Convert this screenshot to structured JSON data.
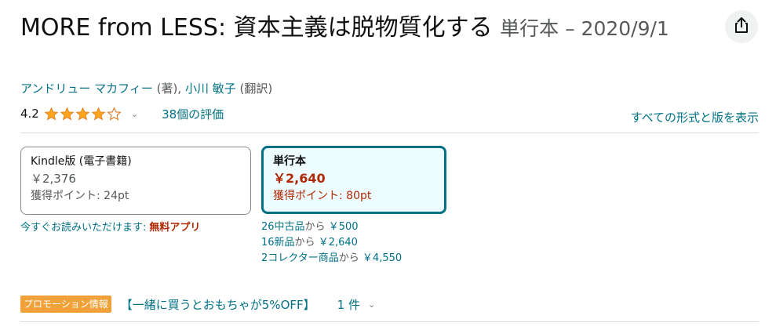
{
  "product": {
    "title_main": "MORE from LESS: 資本主義は脱物質化する",
    "title_format": "単行本 – 2020/9/1"
  },
  "authors": {
    "author_name": "アンドリュー マカフィー",
    "author_role": "(著)",
    "separator": ",",
    "translator_name": "小川 敏子",
    "translator_role": "(翻訳)"
  },
  "rating": {
    "value": "4.2",
    "stars": 4.2,
    "review_count_label": "38個の評価"
  },
  "formats": {
    "all_formats_link": "すべての形式と版を表示",
    "kindle": {
      "name": "Kindle版 (電子書籍)",
      "price": "￥2,376",
      "points": "獲得ポイント: 24pt"
    },
    "tankobon": {
      "name": "単行本",
      "price": "￥2,640",
      "points": "獲得ポイント: 80pt"
    },
    "read_now": {
      "text": "今すぐお読みいただけます:",
      "app_label": "無料アプリ"
    }
  },
  "offers": [
    {
      "label": "26中古品",
      "kara": "から",
      "price": "￥500"
    },
    {
      "label": "16新品",
      "kara": "から",
      "price": "￥2,640"
    },
    {
      "label": "2コレクター商品",
      "kara": "から",
      "price": "￥4,550"
    }
  ],
  "promotion": {
    "badge": "プロモーション情報",
    "link_text": "【一緒に買うとおもちゃが5%OFF】",
    "count": "1 件"
  },
  "colors": {
    "link": "#007185",
    "price_red": "#b12704",
    "star": "#ffa41c",
    "selected_border": "#007185",
    "selected_bg": "#edfdff",
    "promo_badge": "#f0a13a"
  }
}
